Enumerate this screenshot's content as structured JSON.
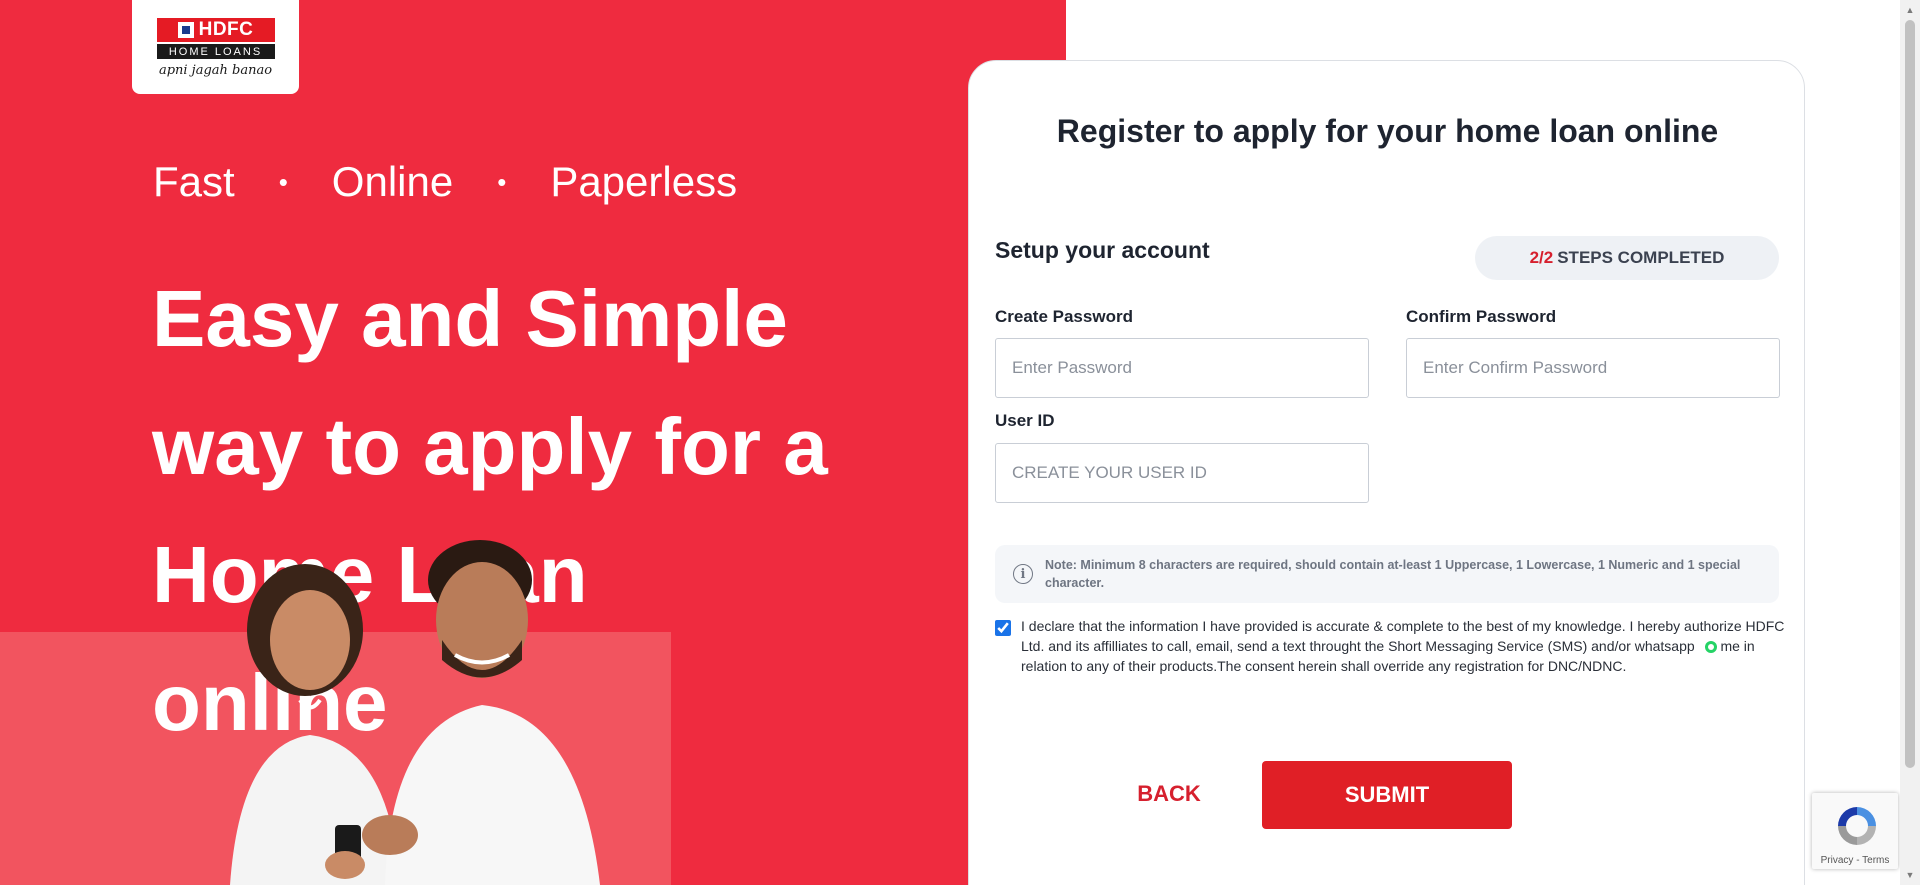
{
  "brand": {
    "logo_top": "HDFC",
    "logo_sub": "HOME LOANS",
    "logo_tagline": "apni jagah banao"
  },
  "hero": {
    "tagline": [
      "Fast",
      "Online",
      "Paperless"
    ],
    "separator": "•",
    "headline": "Easy and Simple way to apply for a Home Loan online"
  },
  "form": {
    "title": "Register to apply for your home loan online",
    "section_title": "Setup your account",
    "steps": {
      "count": "2/2",
      "label": "STEPS COMPLETED"
    },
    "create_password": {
      "label": "Create Password",
      "placeholder": "Enter Password",
      "value": ""
    },
    "confirm_password": {
      "label": "Confirm Password",
      "placeholder": "Enter Confirm Password",
      "value": ""
    },
    "user_id": {
      "label": "User ID",
      "placeholder": "CREATE YOUR USER ID",
      "value": ""
    },
    "note": "Note: Minimum 8 characters are required, should contain at-least 1 Uppercase, 1 Lowercase, 1 Numeric and 1 special character.",
    "consent": {
      "checked": true,
      "text_part1": "I declare that the information I have provided is accurate & complete to the best of my knowledge. I hereby authorize HDFC Ltd. and its affilliates to call, email, send a text throught the Short Messaging Service (SMS) and/or whatsapp",
      "text_part2": "me in relation to any of their products.The consent herein shall override any registration for DNC/NDNC."
    },
    "back_label": "BACK",
    "submit_label": "SUBMIT"
  },
  "recaptcha": {
    "links": "Privacy - Terms"
  },
  "colors": {
    "hero_red": "#ef2b3f",
    "submit_red": "#e01f26",
    "accent_red": "#d6202e",
    "whatsapp_green": "#25d366"
  },
  "icons": [
    "info-icon",
    "whatsapp-icon",
    "recaptcha-icon",
    "checkbox-icon"
  ]
}
